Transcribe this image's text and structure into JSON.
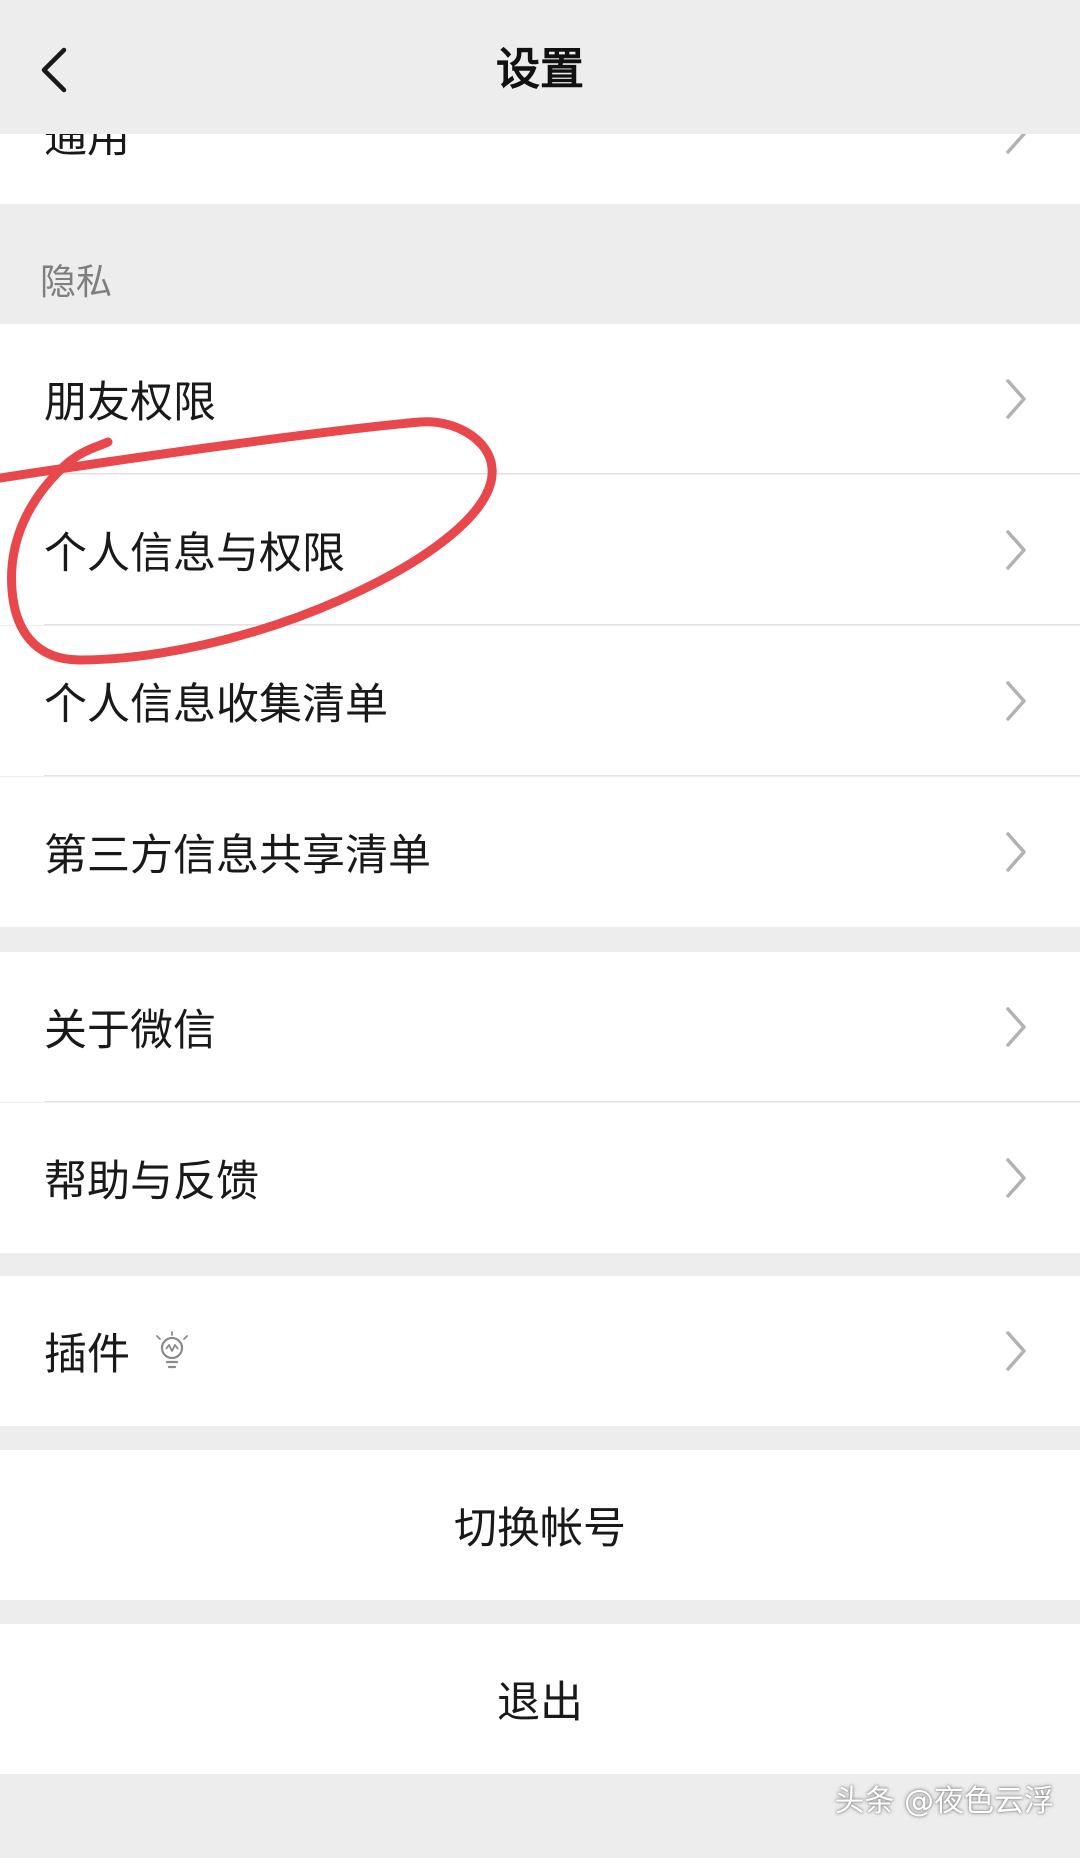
{
  "header": {
    "title": "设置",
    "back_icon": "chevron-left-icon"
  },
  "top_row": {
    "label": "通用"
  },
  "privacy": {
    "section_label": "隐私",
    "items": [
      {
        "label": "朋友权限"
      },
      {
        "label": "个人信息与权限"
      },
      {
        "label": "个人信息收集清单"
      },
      {
        "label": "第三方信息共享清单"
      }
    ]
  },
  "about": {
    "items": [
      {
        "label": "关于微信"
      },
      {
        "label": "帮助与反馈"
      }
    ]
  },
  "plugins": {
    "label": "插件",
    "icon": "lightbulb-icon"
  },
  "actions": {
    "switch_account": "切换帐号",
    "logout": "退出"
  },
  "watermark": "头条 @夜色云浮",
  "colors": {
    "background": "#ededed",
    "row_background": "#ffffff",
    "annotation": "#e8474c",
    "chevron": "#b2b2b2"
  }
}
